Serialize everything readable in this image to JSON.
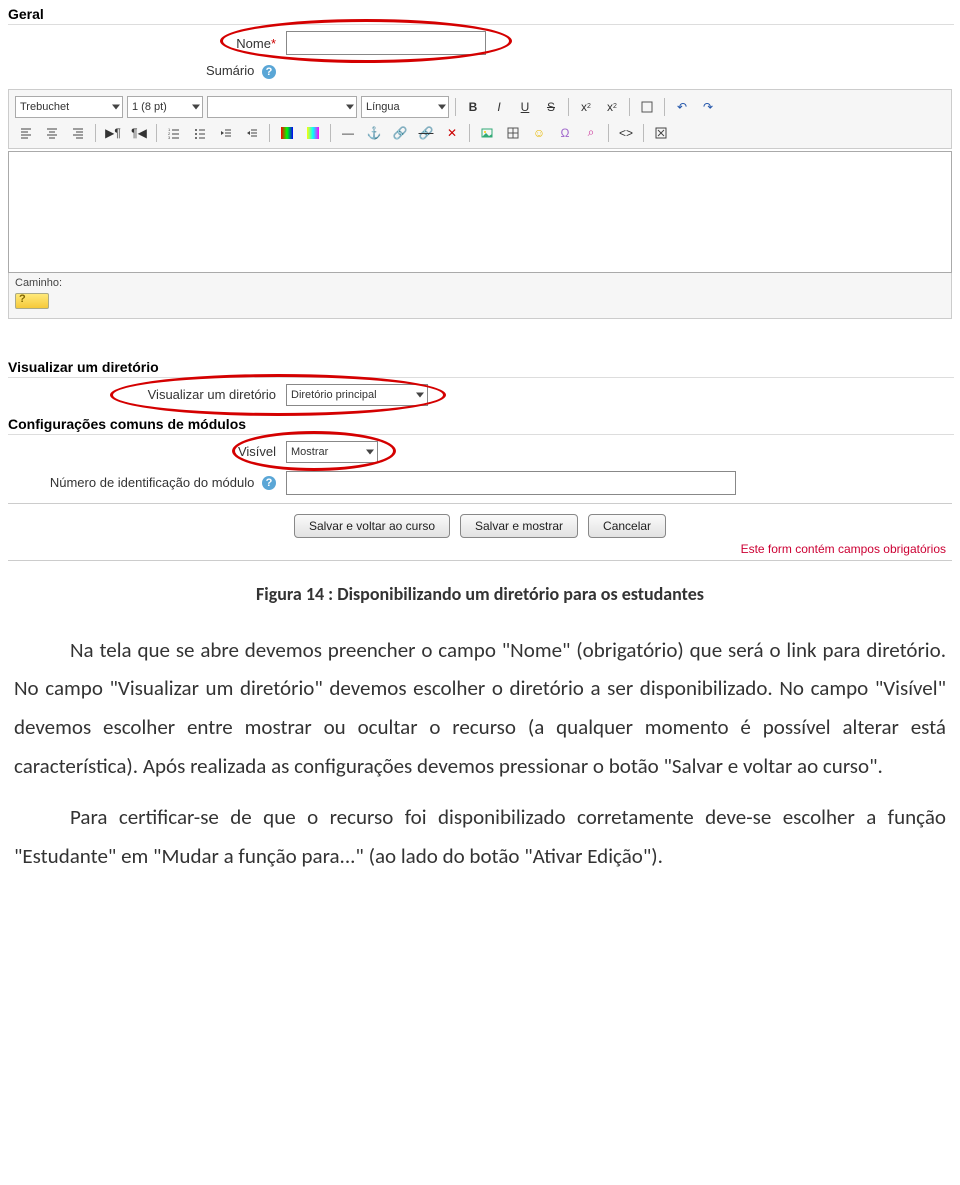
{
  "sections": {
    "geral": "Geral",
    "viewdir": "Visualizar um diretório",
    "common": "Configurações comuns de módulos"
  },
  "fields": {
    "nome_label": "Nome",
    "nome_required_mark": "*",
    "sumario_label": "Sumário",
    "viewdir_label": "Visualizar um diretório",
    "viewdir_value": "Diretório principal",
    "visivel_label": "Visível",
    "visivel_value": "Mostrar",
    "idnum_label": "Número de identificação do módulo"
  },
  "toolbar": {
    "font": "Trebuchet",
    "size": "1 (8 pt)",
    "para": "",
    "lang": "Língua"
  },
  "editor_path_label": "Caminho:",
  "buttons": {
    "save_return": "Salvar e voltar ao curso",
    "save_show": "Salvar e mostrar",
    "cancel": "Cancelar"
  },
  "required_note": "Este form contém campos obrigatórios",
  "doc": {
    "caption": "Figura 14 : Disponibilizando um diretório para os estudantes",
    "p1": "Na tela que se abre devemos preencher o campo \"Nome\" (obrigatório) que será o link para diretório. No campo \"Visualizar um diretório\" devemos escolher o diretório a ser disponibilizado. No campo \"Visível\" devemos escolher entre mostrar ou ocultar o recurso (a qualquer momento é possível alterar está característica). Após realizada as configurações devemos pressionar o botão \"Salvar e voltar ao curso\".",
    "p2": "Para certificar-se de que o recurso foi disponibilizado corretamente deve-se escolher a função \"Estudante\" em \"Mudar a função para...\" (ao lado do botão \"Ativar Edição\")."
  }
}
